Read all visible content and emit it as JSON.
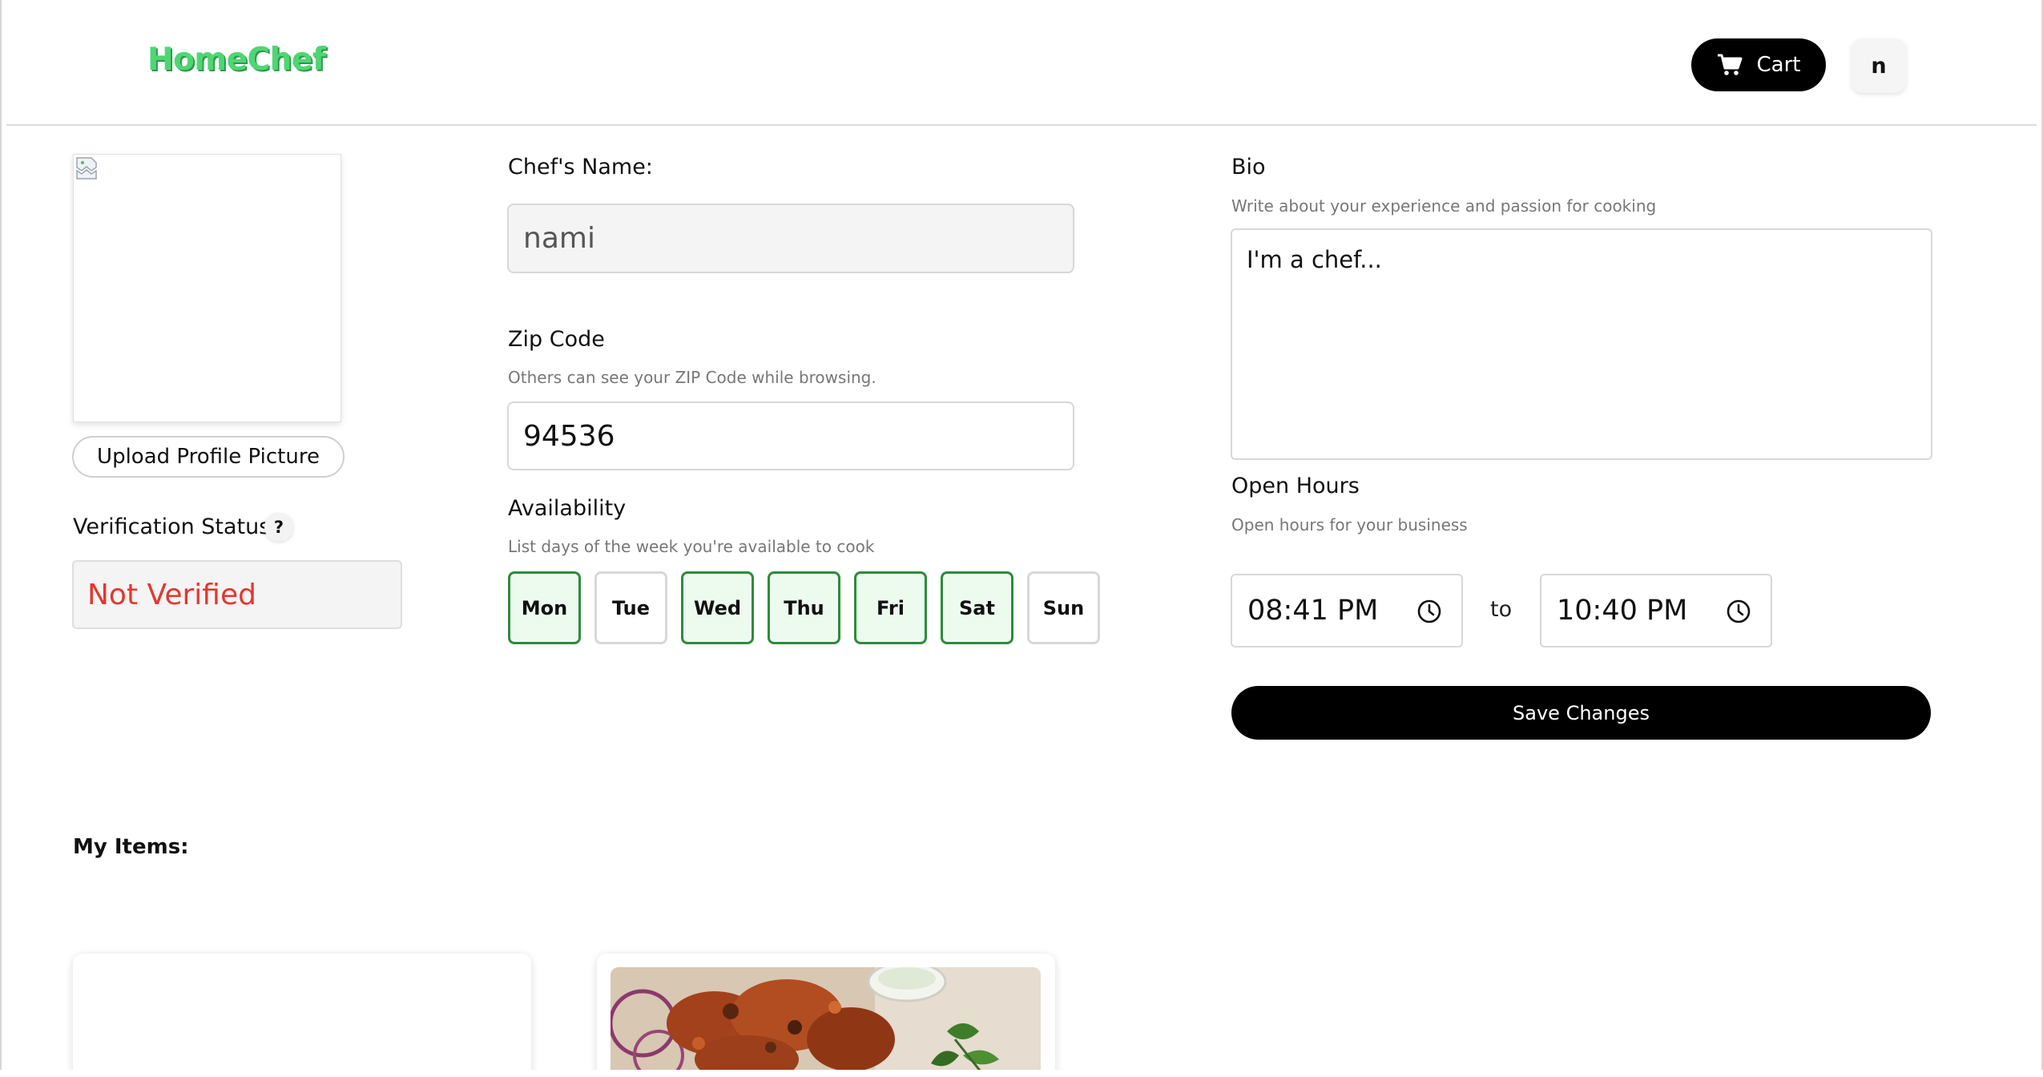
{
  "header": {
    "logo": "HomeChef",
    "cart_label": "Cart",
    "avatar_initial": "n"
  },
  "profile": {
    "upload_label": "Upload Profile Picture",
    "verification_label": "Verification Status",
    "help_glyph": "?",
    "verification_value": "Not Verified"
  },
  "form": {
    "name_label": "Chef's Name:",
    "name_value": "nami",
    "zip_label": "Zip Code",
    "zip_hint": "Others can see your ZIP Code while browsing.",
    "zip_value": "94536",
    "availability_label": "Availability",
    "availability_hint": "List days of the week you're available to cook",
    "days": [
      {
        "label": "Mon",
        "selected": true
      },
      {
        "label": "Tue",
        "selected": false
      },
      {
        "label": "Wed",
        "selected": true
      },
      {
        "label": "Thu",
        "selected": true
      },
      {
        "label": "Fri",
        "selected": true
      },
      {
        "label": "Sat",
        "selected": true
      },
      {
        "label": "Sun",
        "selected": false
      }
    ],
    "bio_label": "Bio",
    "bio_hint": "Write about your experience and passion for cooking",
    "bio_value": "I'm a chef...",
    "hours_label": "Open Hours",
    "hours_hint": "Open hours for your business",
    "open_time": "08:41 PM",
    "to_label": "to",
    "close_time": "10:40 PM",
    "save_label": "Save Changes"
  },
  "items": {
    "title": "My Items:"
  },
  "icons": {
    "cart": "cart-icon",
    "clock": "clock-icon",
    "broken_image": "broken-image-icon"
  },
  "colors": {
    "brand_green": "#4fd672",
    "selected_day_border": "#2e8b3d",
    "selected_day_fill": "#edfbef",
    "not_verified_red": "#e2382e"
  }
}
